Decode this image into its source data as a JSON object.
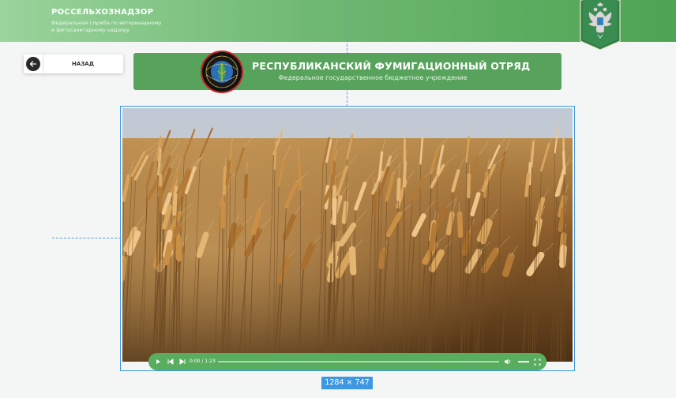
{
  "header": {
    "title": "РОССЕЛЬХОЗНАДЗОР",
    "subtitle_line1": "Федеральная служба по ветеринарному",
    "subtitle_line2": "и фитосанитарному надзору",
    "emblem_icon": "double-headed-eagle-emblem-icon"
  },
  "back_button": {
    "label": "НАЗАД",
    "icon": "arrow-left-icon"
  },
  "banner": {
    "title": "РЕСПУБЛИКАНСКИЙ ФУМИГАЦИОННЫЙ ОТРЯД",
    "subtitle": "Федеральное государственное бюджетное учреждение",
    "logo_icon": "fumigation-squad-logo-icon"
  },
  "video": {
    "content": "wheat-field",
    "time_display": "0:00 / 1:23",
    "progress": 0,
    "controls": [
      "play-icon",
      "skip-back-icon",
      "skip-forward-icon",
      "volume-icon",
      "fullscreen-icon"
    ]
  },
  "dimension_badge": {
    "label": "1284 × 747"
  },
  "colors": {
    "header_green": "#4ea453",
    "banner_green": "#57a35b",
    "controls_green": "#59ad5e",
    "selection_blue": "#3d97e3"
  }
}
